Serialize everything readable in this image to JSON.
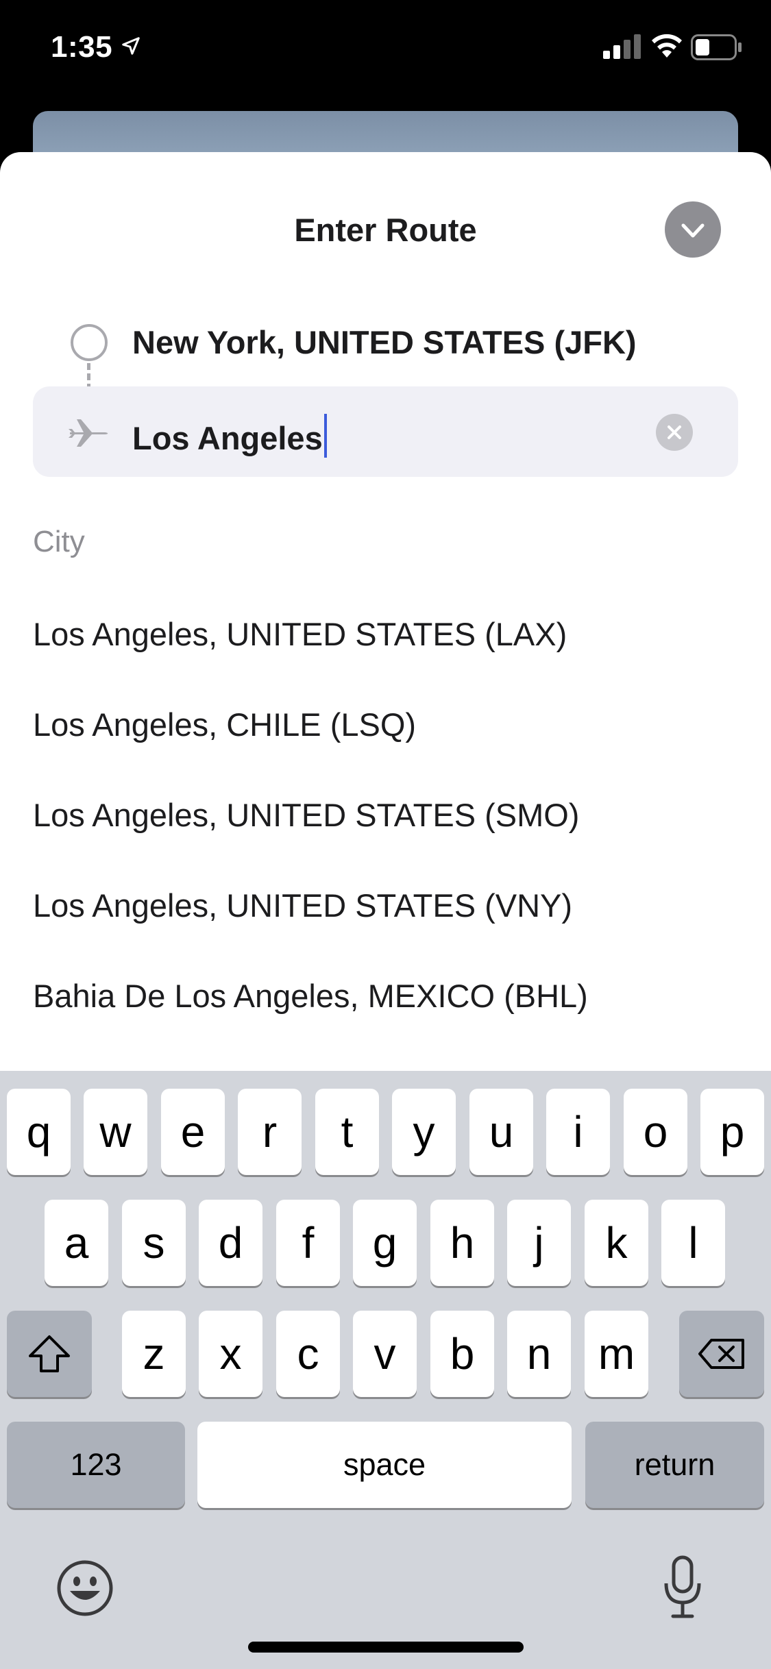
{
  "status_bar": {
    "time": "1:35"
  },
  "sheet": {
    "title": "Enter Route",
    "origin": "New York, UNITED STATES (JFK)",
    "destination_value": "Los Angeles",
    "section_label": "City",
    "results": [
      "Los Angeles, UNITED STATES (LAX)",
      "Los Angeles, CHILE (LSQ)",
      "Los Angeles, UNITED STATES (SMO)",
      "Los Angeles, UNITED STATES (VNY)",
      "Bahia De Los Angeles, MEXICO (BHL)"
    ]
  },
  "keyboard": {
    "row1": [
      "q",
      "w",
      "e",
      "r",
      "t",
      "y",
      "u",
      "i",
      "o",
      "p"
    ],
    "row2": [
      "a",
      "s",
      "d",
      "f",
      "g",
      "h",
      "j",
      "k",
      "l"
    ],
    "row3": [
      "z",
      "x",
      "c",
      "v",
      "b",
      "n",
      "m"
    ],
    "numbers_label": "123",
    "space_label": "space",
    "return_label": "return"
  },
  "icons": {
    "location": "location-arrow-icon",
    "signal": "cellular-signal-icon",
    "wifi": "wifi-icon",
    "battery": "battery-icon",
    "collapse": "chevron-down-icon",
    "plane": "airplane-icon",
    "clear": "clear-icon",
    "shift": "shift-icon",
    "delete": "backspace-icon",
    "emoji": "emoji-icon",
    "mic": "microphone-icon"
  },
  "colors": {
    "caret": "#3b5bdb",
    "sheet_bg": "#ffffff",
    "keyboard_bg": "#d2d5db"
  }
}
